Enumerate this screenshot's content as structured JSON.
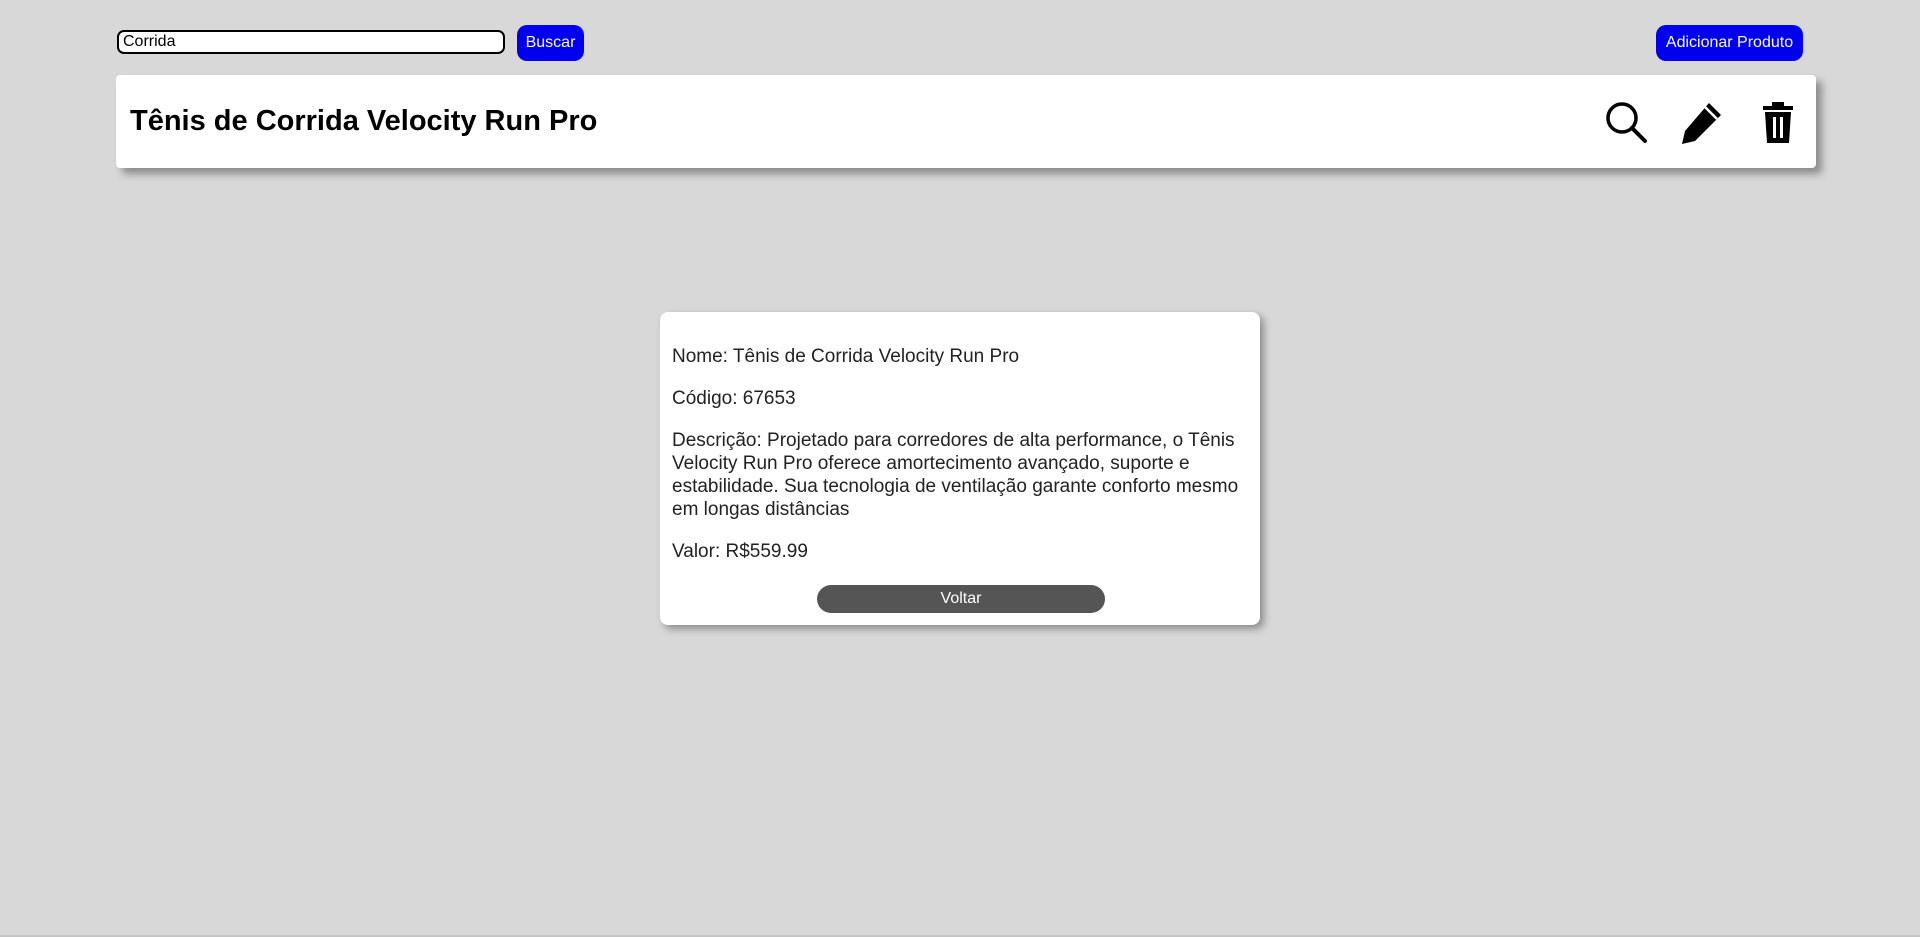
{
  "search": {
    "value": "Corrida",
    "button_label": "Buscar"
  },
  "toolbar": {
    "add_label": "Adicionar Produto"
  },
  "header": {
    "title": "Tênis de Corrida Velocity Run Pro",
    "icons": [
      "search-icon",
      "pencil-icon",
      "trash-icon"
    ]
  },
  "product": {
    "name": "Nome: Tênis de Corrida Velocity Run Pro",
    "code": "Código: 67653",
    "description": "Descrição: Projetado para corredores de alta performance, o Tênis Velocity Run Pro oferece amortecimento avançado, suporte e estabilidade. Sua tecnologia de ventilação garante conforto mesmo em longas distâncias",
    "price": "Valor: R$559.99",
    "back_label": "Voltar"
  },
  "colors": {
    "background": "#d8d8d8",
    "primary_button": "#0000ee",
    "back_button": "#555555"
  }
}
